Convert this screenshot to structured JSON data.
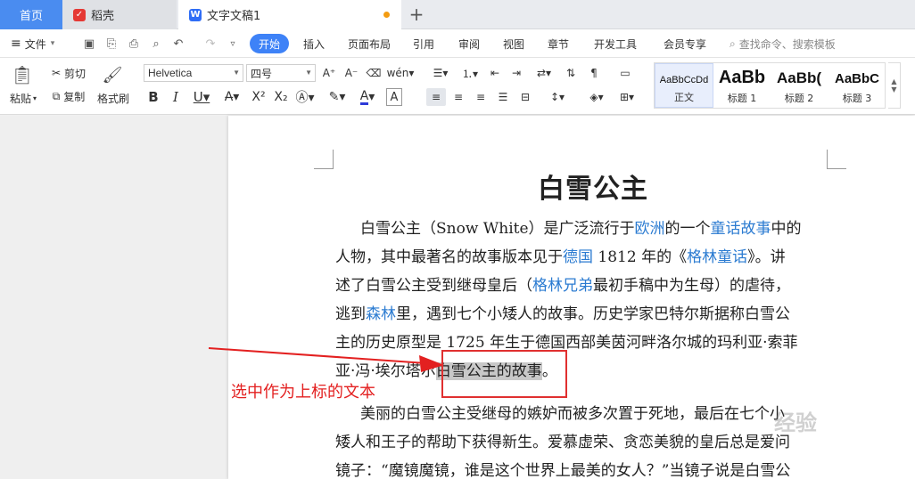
{
  "tabs": {
    "home": "首页",
    "daoke": "稻壳",
    "doc": "文字文稿1",
    "add": "+"
  },
  "menu": {
    "file": "文件",
    "items": [
      "开始",
      "插入",
      "页面布局",
      "引用",
      "审阅",
      "视图",
      "章节",
      "开发工具",
      "会员专享"
    ],
    "search": "查找命令、搜索模板"
  },
  "ribbon": {
    "paste": "粘贴",
    "cut": "剪切",
    "copy": "复制",
    "format_painter": "格式刷",
    "font_name": "Helvetica",
    "font_size": "四号",
    "styles": [
      {
        "sample": "AaBbCcDd",
        "label": "正文"
      },
      {
        "sample": "AaBb",
        "label": "标题 1"
      },
      {
        "sample": "AaBb(",
        "label": "标题 2"
      },
      {
        "sample": "AaBbC",
        "label": "标题 3"
      }
    ]
  },
  "document": {
    "title": "白雪公主",
    "p1": {
      "l1": [
        "白雪公主（Snow White）是广泛流行于",
        "欧洲",
        "的一个",
        "童话故事",
        "中的"
      ],
      "l2": [
        "人物，其中最著名的故事版本见于",
        "德国",
        " 1812 年的《",
        "格林童话",
        "》。讲"
      ],
      "l3": [
        "述了白雪公主受到继母皇后（",
        "格林兄弟",
        "最初手稿中为生母）的虐待，"
      ],
      "l4": [
        "逃到",
        "森林",
        "里，遇到七个小矮人的故事。历史学家巴特尔斯据称白雪公"
      ],
      "l5": "主的历史原型是 1725 年生于德国西部美茵河畔洛尔城的玛利亚·索菲",
      "l6": [
        "亚·冯·埃尔塔尔",
        "白雪公主的故事",
        "。"
      ]
    },
    "p2": {
      "l1": "美丽的白雪公主受继母的嫉妒而被多次置于死地，最后在七个小",
      "l2": "矮人和王子的帮助下获得新生。爱慕虚荣、贪恋美貌的皇后总是爱问",
      "l3": "镜子：“魔镜魔镜，谁是这个世界上最美的女人？”当镜子说是白雪公"
    }
  },
  "annotation": {
    "label": "选中作为上标的文本",
    "color": "#e32020"
  },
  "watermark": "经验"
}
